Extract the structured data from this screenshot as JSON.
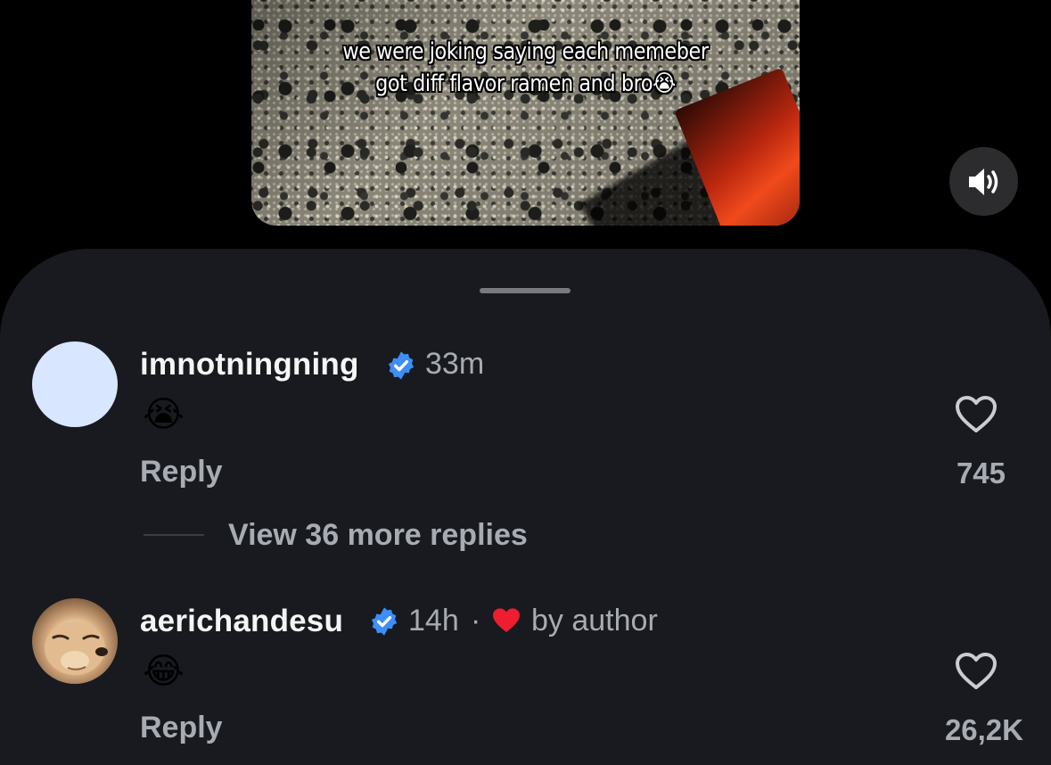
{
  "video": {
    "caption_line1": "we were joking saying each memeber",
    "caption_line2": "got diff flavor ramen and bro😭"
  },
  "sound_button": {
    "icon": "speaker-volume-icon"
  },
  "comments": [
    {
      "username": "imnotningning",
      "verified": true,
      "time": "33m",
      "text": "😭",
      "reply_label": "Reply",
      "likes": "745",
      "view_more": "View 36 more replies"
    },
    {
      "username": "aerichandesu",
      "verified": true,
      "time": "14h",
      "separator": "·",
      "liked_by_author": "by author",
      "text": "😂",
      "reply_label": "Reply",
      "likes": "26,2K"
    }
  ],
  "colors": {
    "sheet_bg": "#181a1f",
    "verified_blue": "#3d8ef5",
    "author_heart_red": "#ee1d2f",
    "muted_text": "#a7abb2"
  }
}
